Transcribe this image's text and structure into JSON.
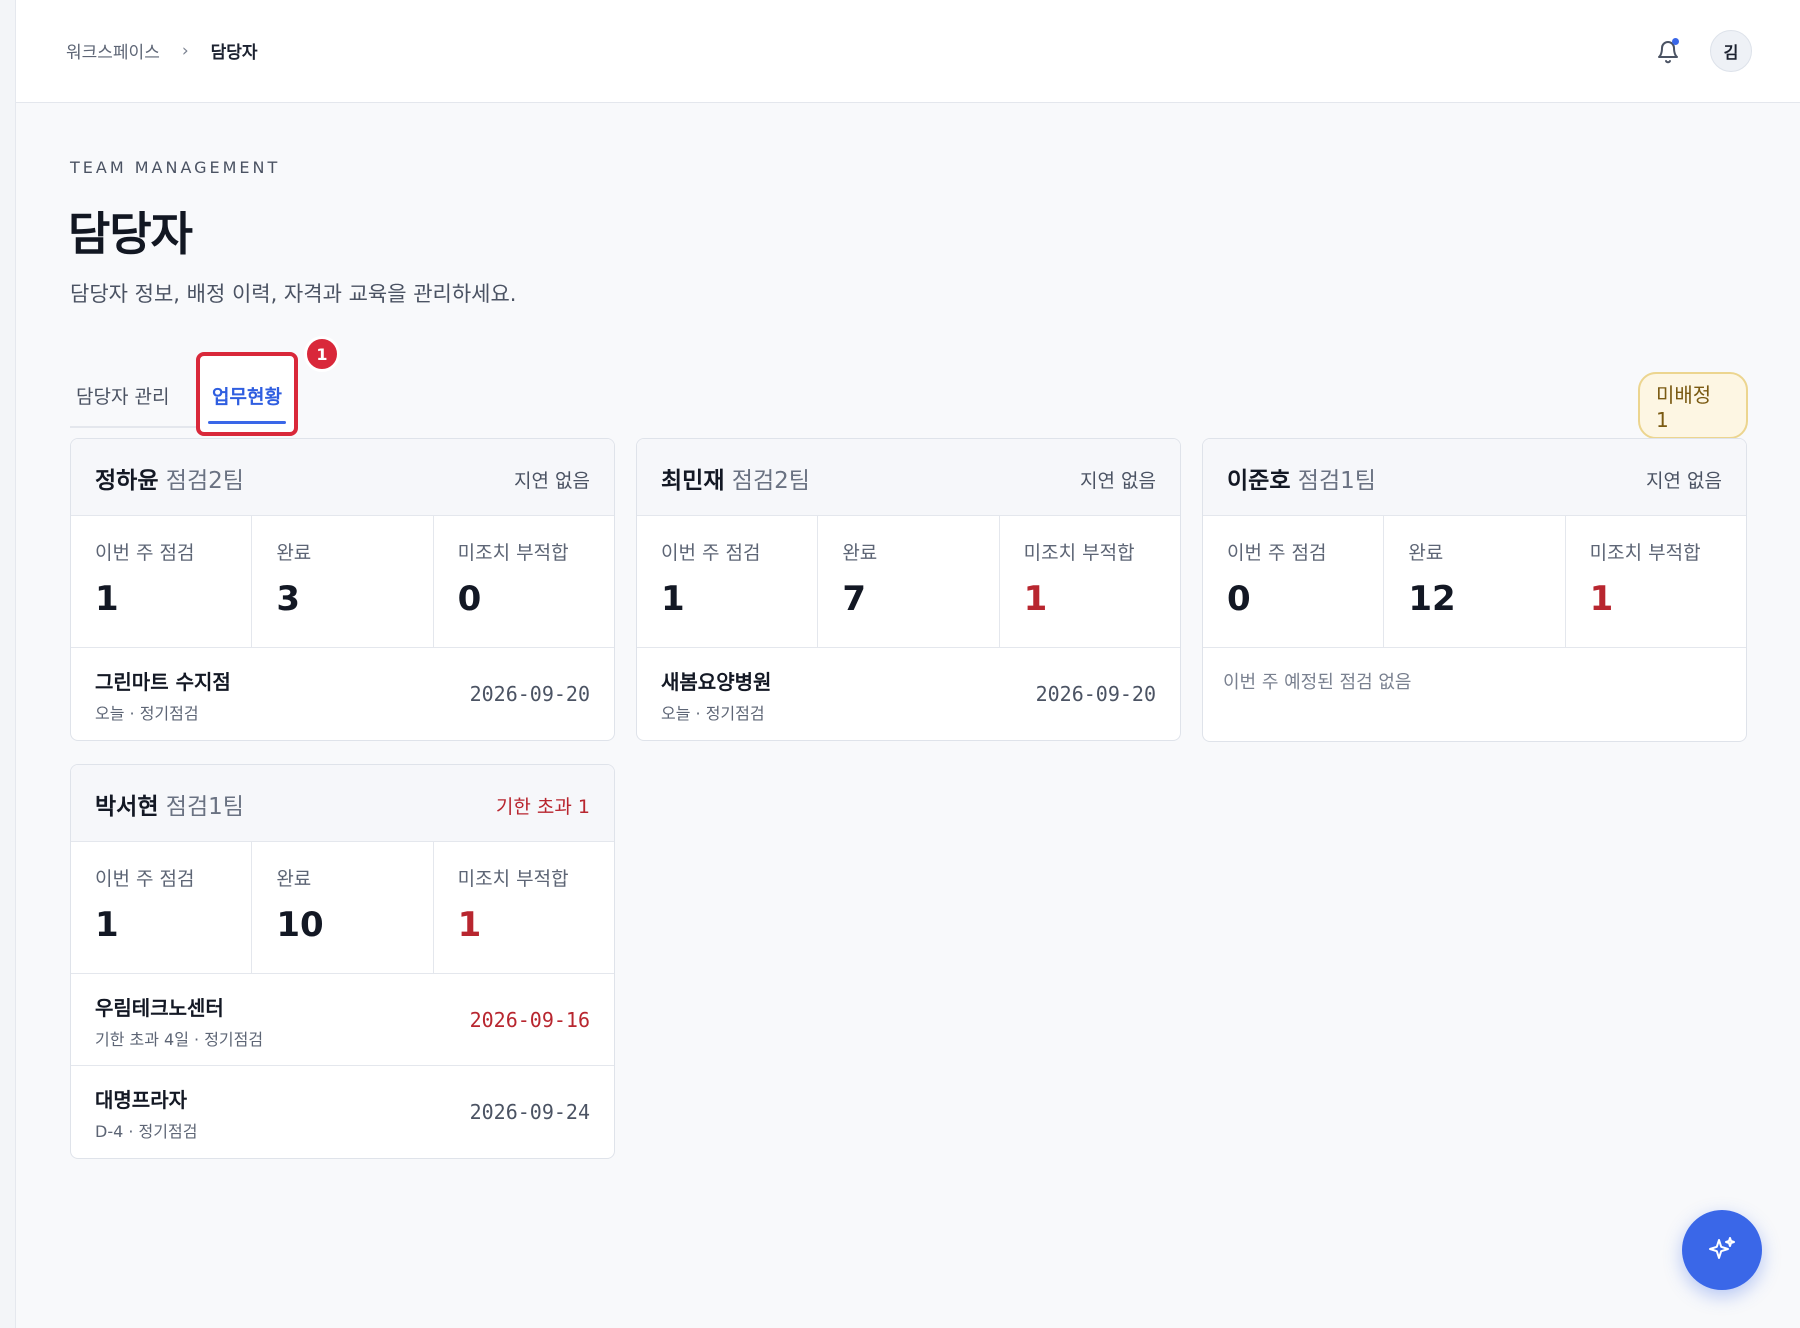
{
  "breadcrumb": {
    "root": "워크스페이스",
    "separator": "›",
    "current": "담당자"
  },
  "header": {
    "avatar_initial": "김",
    "notification_dot": true
  },
  "page": {
    "eyebrow": "TEAM MANAGEMENT",
    "title": "담당자",
    "subtitle": "담당자 정보, 배정 이력, 자격과 교육을 관리하세요."
  },
  "tabs": [
    {
      "label": "담당자 관리",
      "active": false
    },
    {
      "label": "업무현황",
      "active": true,
      "badge": "1"
    }
  ],
  "unassigned_badge": "미배정 1",
  "stat_labels": {
    "week": "이번 주 점검",
    "done": "완료",
    "nonconf": "미조치 부적합"
  },
  "cards": [
    {
      "name": "정하윤",
      "team": "점검2팀",
      "status": "지연 없음",
      "week": "1",
      "done": "3",
      "nonconf": "0",
      "tasks": [
        {
          "name": "그린마트 수지점",
          "meta": "오늘 · 정기점검",
          "date": "2026-09-20"
        }
      ]
    },
    {
      "name": "최민재",
      "team": "점검2팀",
      "status": "지연 없음",
      "week": "1",
      "done": "7",
      "nonconf": "1",
      "tasks": [
        {
          "name": "새봄요양병원",
          "meta": "오늘 · 정기점검",
          "date": "2026-09-20"
        }
      ]
    },
    {
      "name": "이준호",
      "team": "점검1팀",
      "status": "지연 없음",
      "week": "0",
      "done": "12",
      "nonconf": "1",
      "empty": "이번 주 예정된 점검 없음"
    },
    {
      "name": "박서현",
      "team": "점검1팀",
      "status": "기한 초과 1",
      "week": "1",
      "done": "10",
      "nonconf": "1",
      "tasks": [
        {
          "name": "우림테크노센터",
          "meta": "기한 초과 4일 · 정기점검",
          "date": "2026-09-16"
        },
        {
          "name": "대명프라자",
          "meta": "D-4 · 정기점검",
          "date": "2026-09-24"
        }
      ]
    }
  ],
  "colors": {
    "accent": "#3a67e8",
    "danger": "#b8262f",
    "highlight": "#d9283a"
  },
  "fab": {
    "icon": "sparkles-icon"
  }
}
